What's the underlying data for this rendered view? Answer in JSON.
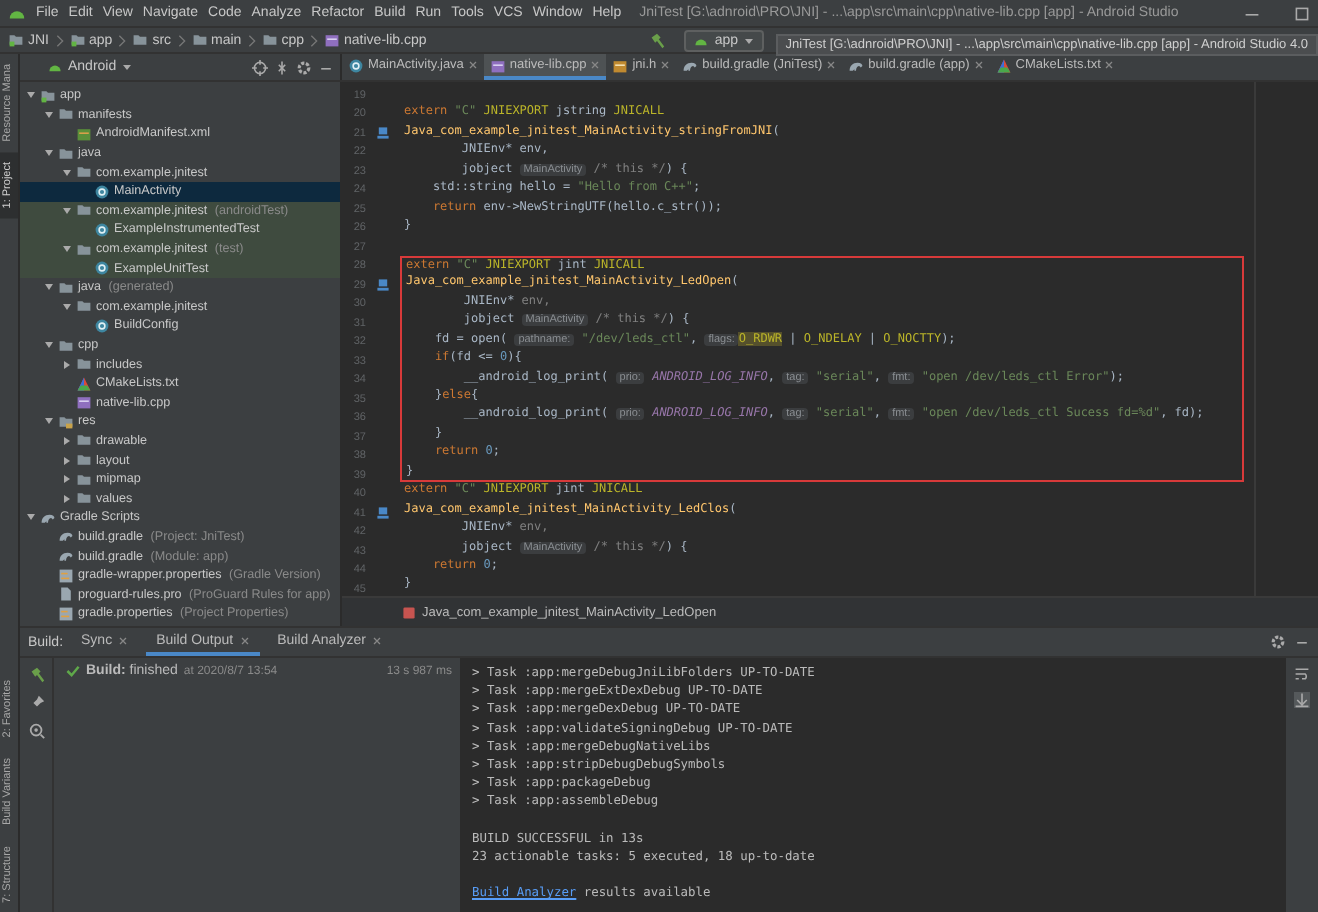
{
  "menu_bar": {
    "items": [
      "File",
      "Edit",
      "View",
      "Navigate",
      "Code",
      "Analyze",
      "Refactor",
      "Build",
      "Run",
      "Tools",
      "VCS",
      "Window",
      "Help"
    ],
    "title": "JniTest [G:\\adnroid\\PRO\\JNI] - ...\\app\\src\\main\\cpp\\native-lib.cpp [app] - Android Studio"
  },
  "nav_bar": {
    "crumbs": [
      {
        "label": "JNI",
        "kind": "module"
      },
      {
        "label": "app",
        "kind": "module"
      },
      {
        "label": "src",
        "kind": "folder"
      },
      {
        "label": "main",
        "kind": "folder"
      },
      {
        "label": "cpp",
        "kind": "folder"
      },
      {
        "label": "native-lib.cpp",
        "kind": "cpp"
      }
    ],
    "run_config": "app"
  },
  "tooltip": "JniTest [G:\\adnroid\\PRO\\JNI] - ...\\app\\src\\main\\cpp\\native-lib.cpp [app] - Android Studio 4.0",
  "left_strip": {
    "top": [
      {
        "label": "Resource Mana",
        "selected": false
      },
      {
        "label": "1: Project",
        "selected": true
      }
    ],
    "bottom": [
      {
        "label": "2: Favorites",
        "selected": false
      },
      {
        "label": "Build Variants",
        "selected": false
      },
      {
        "label": "7: Structure",
        "selected": false
      }
    ]
  },
  "project_panel": {
    "view": "Android",
    "tree": [
      {
        "label": "app",
        "kind": "module",
        "expanded": true,
        "selected": false,
        "test": false,
        "children": [
          {
            "label": "manifests",
            "kind": "folder",
            "expanded": true,
            "selected": false,
            "test": false,
            "children": [
              {
                "label": "AndroidManifest.xml",
                "kind": "xml",
                "selected": false,
                "test": false
              }
            ]
          },
          {
            "label": "java",
            "kind": "folder",
            "expanded": true,
            "selected": false,
            "test": false,
            "children": [
              {
                "label": "com.example.jnitest",
                "kind": "folder",
                "expanded": true,
                "selected": false,
                "test": false,
                "children": [
                  {
                    "label": "MainActivity",
                    "kind": "class",
                    "selected": true,
                    "test": false
                  }
                ]
              },
              {
                "label": "com.example.jnitest",
                "note": "(androidTest)",
                "kind": "folder",
                "expanded": true,
                "selected": false,
                "test": true,
                "children": [
                  {
                    "label": "ExampleInstrumentedTest",
                    "kind": "class",
                    "selected": false,
                    "test": true
                  }
                ]
              },
              {
                "label": "com.example.jnitest",
                "note": "(test)",
                "kind": "folder",
                "expanded": true,
                "selected": false,
                "test": true,
                "children": [
                  {
                    "label": "ExampleUnitTest",
                    "kind": "class",
                    "selected": false,
                    "test": true
                  }
                ]
              }
            ]
          },
          {
            "label": "java",
            "note": "(generated)",
            "kind": "folder",
            "expanded": true,
            "selected": false,
            "test": false,
            "children": [
              {
                "label": "com.example.jnitest",
                "kind": "folder",
                "expanded": true,
                "selected": false,
                "test": false,
                "children": [
                  {
                    "label": "BuildConfig",
                    "kind": "class",
                    "selected": false,
                    "test": false
                  }
                ]
              }
            ]
          },
          {
            "label": "cpp",
            "kind": "folder",
            "expanded": true,
            "selected": false,
            "test": false,
            "children": [
              {
                "label": "includes",
                "kind": "folder",
                "expanded": false,
                "selected": false,
                "test": false
              },
              {
                "label": "CMakeLists.txt",
                "kind": "cmake",
                "selected": false,
                "test": false
              },
              {
                "label": "native-lib.cpp",
                "kind": "cpp",
                "selected": false,
                "test": false
              }
            ]
          },
          {
            "label": "res",
            "kind": "res",
            "expanded": true,
            "selected": false,
            "test": false,
            "children": [
              {
                "label": "drawable",
                "kind": "folder",
                "expanded": false,
                "selected": false,
                "test": false
              },
              {
                "label": "layout",
                "kind": "folder",
                "expanded": false,
                "selected": false,
                "test": false
              },
              {
                "label": "mipmap",
                "kind": "folder",
                "expanded": false,
                "selected": false,
                "test": false
              },
              {
                "label": "values",
                "kind": "folder",
                "expanded": false,
                "selected": false,
                "test": false
              }
            ]
          }
        ]
      },
      {
        "label": "Gradle Scripts",
        "kind": "gradle",
        "expanded": true,
        "selected": false,
        "test": false,
        "children": [
          {
            "label": "build.gradle",
            "note": "(Project: JniTest)",
            "kind": "gradle",
            "selected": false,
            "test": false
          },
          {
            "label": "build.gradle",
            "note": "(Module: app)",
            "kind": "gradle",
            "selected": false,
            "test": false
          },
          {
            "label": "gradle-wrapper.properties",
            "note": "(Gradle Version)",
            "kind": "properties",
            "selected": false,
            "test": false
          },
          {
            "label": "proguard-rules.pro",
            "note": "(ProGuard Rules for app)",
            "kind": "file",
            "selected": false,
            "test": false
          },
          {
            "label": "gradle.properties",
            "note": "(Project Properties)",
            "kind": "properties",
            "selected": false,
            "test": false
          }
        ]
      }
    ]
  },
  "editor": {
    "tabs": [
      {
        "label": "MainActivity.java",
        "kind": "class",
        "selected": false
      },
      {
        "label": "native-lib.cpp",
        "kind": "cpp",
        "selected": true
      },
      {
        "label": "jni.h",
        "kind": "header",
        "selected": false
      },
      {
        "label": "build.gradle (JniTest)",
        "kind": "gradle",
        "selected": false
      },
      {
        "label": "build.gradle (app)",
        "kind": "gradle",
        "selected": false
      },
      {
        "label": "CMakeLists.txt",
        "kind": "cmake",
        "selected": false
      }
    ],
    "lines": [
      {
        "num": "19",
        "marker": false,
        "boxed": false
      },
      {
        "num": "20",
        "marker": false,
        "boxed": false,
        "segs": [
          {
            "kind": "kw",
            "text": "extern "
          },
          {
            "kind": "str",
            "text": "\"C\" "
          },
          {
            "kind": "macro",
            "text": "JNIEXPORT "
          },
          {
            "kind": "plain",
            "text": "jstring "
          },
          {
            "kind": "macro",
            "text": "JNICALL"
          }
        ]
      },
      {
        "num": "21",
        "marker": true,
        "boxed": false,
        "segs": [
          {
            "kind": "fn",
            "text": "Java_com_example_jnitest_MainActivity_stringFromJNI"
          },
          {
            "kind": "plain",
            "text": "("
          }
        ]
      },
      {
        "num": "22",
        "marker": false,
        "boxed": false,
        "segs": [
          {
            "kind": "plain",
            "text": "        JNIEnv* env,"
          }
        ]
      },
      {
        "num": "23",
        "marker": false,
        "boxed": false,
        "segs": [
          {
            "kind": "plain",
            "text": "        jobject "
          },
          {
            "kind": "hint",
            "text": "MainActivity"
          },
          {
            "kind": "comment",
            "text": " /* this */"
          },
          {
            "kind": "plain",
            "text": ") {"
          }
        ]
      },
      {
        "num": "24",
        "marker": false,
        "boxed": false,
        "segs": [
          {
            "kind": "plain",
            "text": "    std::string hello = "
          },
          {
            "kind": "str",
            "text": "\"Hello from C++\""
          },
          {
            "kind": "plain",
            "text": ";"
          }
        ]
      },
      {
        "num": "25",
        "marker": false,
        "boxed": false,
        "segs": [
          {
            "kind": "kw",
            "text": "    return "
          },
          {
            "kind": "plain",
            "text": "env->NewStringUTF(hello.c_str());"
          }
        ]
      },
      {
        "num": "26",
        "marker": false,
        "boxed": false,
        "segs": [
          {
            "kind": "plain",
            "text": "}"
          }
        ]
      },
      {
        "num": "27",
        "marker": false,
        "boxed": false
      },
      {
        "num": "28",
        "marker": false,
        "boxed": true,
        "segs": [
          {
            "kind": "kw",
            "text": "extern "
          },
          {
            "kind": "str",
            "text": "\"C\" "
          },
          {
            "kind": "macro",
            "text": "JNIEXPORT "
          },
          {
            "kind": "plain",
            "text": "jint "
          },
          {
            "kind": "macro",
            "text": "JNICALL"
          }
        ]
      },
      {
        "num": "29",
        "marker": true,
        "boxed": true,
        "segs": [
          {
            "kind": "fn",
            "text": "Java_com_example_jnitest_MainActivity_LedOpen"
          },
          {
            "kind": "plain",
            "text": "("
          }
        ]
      },
      {
        "num": "30",
        "marker": false,
        "boxed": true,
        "segs": [
          {
            "kind": "plain",
            "text": "        JNIEnv* "
          },
          {
            "kind": "comment",
            "text": "env,"
          }
        ]
      },
      {
        "num": "31",
        "marker": false,
        "boxed": true,
        "segs": [
          {
            "kind": "plain",
            "text": "        jobject "
          },
          {
            "kind": "hint",
            "text": "MainActivity"
          },
          {
            "kind": "comment",
            "text": " /* this */"
          },
          {
            "kind": "plain",
            "text": ") {"
          }
        ]
      },
      {
        "num": "32",
        "marker": false,
        "boxed": true,
        "segs": [
          {
            "kind": "plain",
            "text": "    fd = open( "
          },
          {
            "kind": "hint",
            "text": "pathname:"
          },
          {
            "kind": "str",
            "text": " \"/dev/leds_ctl\""
          },
          {
            "kind": "plain",
            "text": ", "
          },
          {
            "kind": "hint",
            "text": "flags:"
          },
          {
            "kind": "hl",
            "text": "O_RDWR"
          },
          {
            "kind": "plain",
            "text": " | "
          },
          {
            "kind": "macro",
            "text": "O_NDELAY"
          },
          {
            "kind": "plain",
            "text": " | "
          },
          {
            "kind": "macro",
            "text": "O_NOCTTY"
          },
          {
            "kind": "plain",
            "text": ");"
          }
        ]
      },
      {
        "num": "33",
        "marker": false,
        "boxed": true,
        "segs": [
          {
            "kind": "kw",
            "text": "    if"
          },
          {
            "kind": "plain",
            "text": "(fd <= "
          },
          {
            "kind": "num",
            "text": "0"
          },
          {
            "kind": "plain",
            "text": "){"
          }
        ]
      },
      {
        "num": "34",
        "marker": false,
        "boxed": true,
        "segs": [
          {
            "kind": "plain",
            "text": "        __android_log_print( "
          },
          {
            "kind": "hint",
            "text": "prio:"
          },
          {
            "kind": "const",
            "text": " ANDROID_LOG_INFO"
          },
          {
            "kind": "plain",
            "text": ", "
          },
          {
            "kind": "hint",
            "text": "tag:"
          },
          {
            "kind": "str",
            "text": " \"serial\""
          },
          {
            "kind": "plain",
            "text": ", "
          },
          {
            "kind": "hint",
            "text": "fmt:"
          },
          {
            "kind": "str",
            "text": " \"open /dev/leds_ctl Error\""
          },
          {
            "kind": "plain",
            "text": ");"
          }
        ]
      },
      {
        "num": "35",
        "marker": false,
        "boxed": true,
        "segs": [
          {
            "kind": "plain",
            "text": "    }"
          },
          {
            "kind": "kw",
            "text": "else"
          },
          {
            "kind": "plain",
            "text": "{"
          }
        ]
      },
      {
        "num": "36",
        "marker": false,
        "boxed": true,
        "segs": [
          {
            "kind": "plain",
            "text": "        __android_log_print( "
          },
          {
            "kind": "hint",
            "text": "prio:"
          },
          {
            "kind": "const",
            "text": " ANDROID_LOG_INFO"
          },
          {
            "kind": "plain",
            "text": ", "
          },
          {
            "kind": "hint",
            "text": "tag:"
          },
          {
            "kind": "str",
            "text": " \"serial\""
          },
          {
            "kind": "plain",
            "text": ", "
          },
          {
            "kind": "hint",
            "text": "fmt:"
          },
          {
            "kind": "str",
            "text": " \"open /dev/leds_ctl Sucess fd=%d\""
          },
          {
            "kind": "plain",
            "text": ", fd);"
          }
        ]
      },
      {
        "num": "37",
        "marker": false,
        "boxed": true,
        "segs": [
          {
            "kind": "plain",
            "text": "    }"
          }
        ]
      },
      {
        "num": "38",
        "marker": false,
        "boxed": true,
        "segs": [
          {
            "kind": "kw",
            "text": "    return "
          },
          {
            "kind": "num",
            "text": "0"
          },
          {
            "kind": "plain",
            "text": ";"
          }
        ]
      },
      {
        "num": "39",
        "marker": false,
        "boxed": true,
        "segs": [
          {
            "kind": "plain",
            "text": "}"
          }
        ]
      },
      {
        "num": "40",
        "marker": false,
        "boxed": false,
        "segs": [
          {
            "kind": "kw",
            "text": "extern "
          },
          {
            "kind": "str",
            "text": "\"C\" "
          },
          {
            "kind": "macro",
            "text": "JNIEXPORT "
          },
          {
            "kind": "plain",
            "text": "jint "
          },
          {
            "kind": "macro",
            "text": "JNICALL"
          }
        ]
      },
      {
        "num": "41",
        "marker": true,
        "boxed": false,
        "segs": [
          {
            "kind": "fn",
            "text": "Java_com_example_jnitest_MainActivity_LedClos"
          },
          {
            "kind": "plain",
            "text": "("
          }
        ]
      },
      {
        "num": "42",
        "marker": false,
        "boxed": false,
        "segs": [
          {
            "kind": "plain",
            "text": "        JNIEnv* "
          },
          {
            "kind": "comment",
            "text": "env,"
          }
        ]
      },
      {
        "num": "43",
        "marker": false,
        "boxed": false,
        "segs": [
          {
            "kind": "plain",
            "text": "        jobject "
          },
          {
            "kind": "hint",
            "text": "MainActivity"
          },
          {
            "kind": "comment",
            "text": " /* this */"
          },
          {
            "kind": "plain",
            "text": ") {"
          }
        ]
      },
      {
        "num": "44",
        "marker": false,
        "boxed": false,
        "segs": [
          {
            "kind": "kw",
            "text": "    return "
          },
          {
            "kind": "num",
            "text": "0"
          },
          {
            "kind": "plain",
            "text": ";"
          }
        ]
      },
      {
        "num": "45",
        "marker": false,
        "boxed": false,
        "segs": [
          {
            "kind": "plain",
            "text": "}"
          }
        ]
      }
    ],
    "breadcrumb": "Java_com_example_jnitest_MainActivity_LedOpen"
  },
  "build_panel": {
    "title": "Build:",
    "tabs": [
      {
        "label": "Sync",
        "selected": false
      },
      {
        "label": "Build Output",
        "selected": true
      },
      {
        "label": "Build Analyzer",
        "selected": false
      }
    ],
    "status_text": "**Build:** finished",
    "status_time": "at 2020/8/7 13:54",
    "duration": "13 s 987 ms",
    "tasks": [
      "> Task :app:mergeDebugJniLibFolders UP-TO-DATE",
      "> Task :app:mergeExtDexDebug UP-TO-DATE",
      "> Task :app:mergeDexDebug UP-TO-DATE",
      "> Task :app:validateSigningDebug UP-TO-DATE",
      "> Task :app:mergeDebugNativeLibs",
      "> Task :app:stripDebugDebugSymbols",
      "> Task :app:packageDebug",
      "> Task :app:assembleDebug"
    ],
    "summary": [
      "BUILD SUCCESSFUL in 13s",
      "23 actionable tasks: 5 executed, 18 up-to-date"
    ],
    "link": "Build Analyzer",
    "link_suffix": " results available"
  }
}
